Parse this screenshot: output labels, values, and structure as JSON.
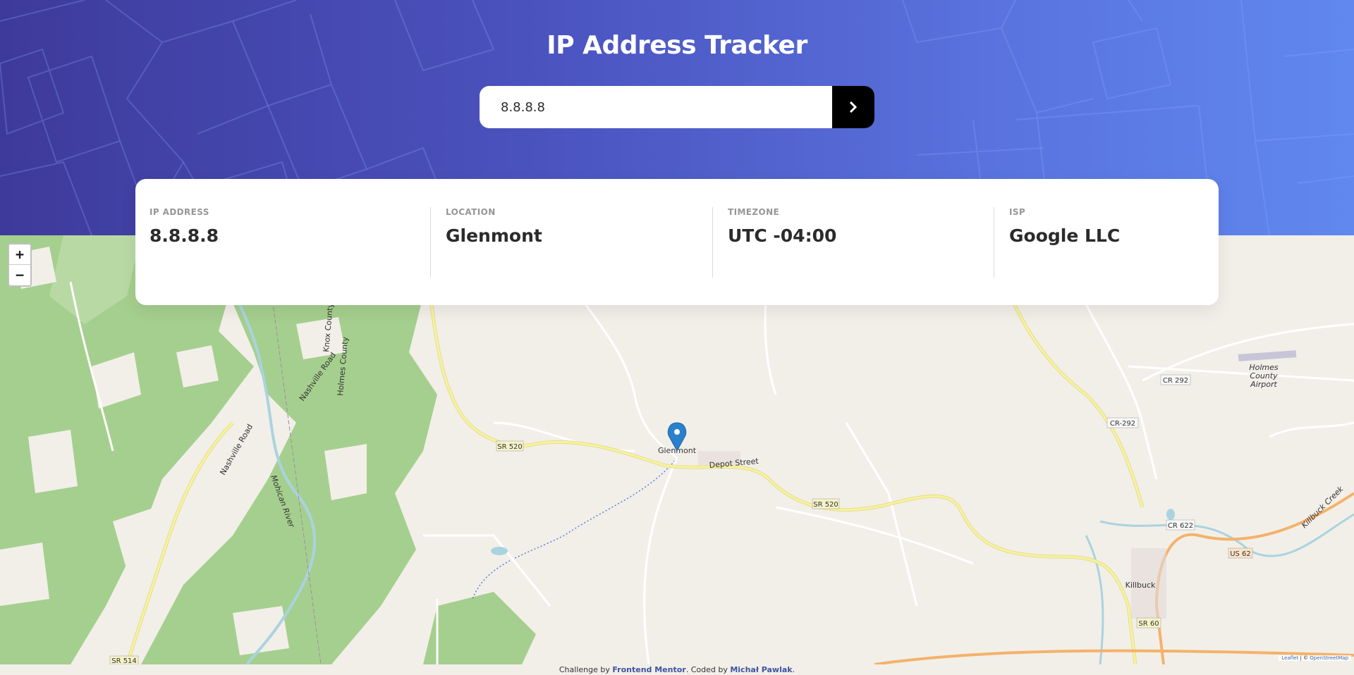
{
  "header": {
    "title": "IP Address Tracker",
    "search_value": "8.8.8.8",
    "submit_icon": "chevron-right-icon"
  },
  "info": {
    "ip": {
      "label": "IP ADDRESS",
      "value": "8.8.8.8"
    },
    "location": {
      "label": "LOCATION",
      "value": "Glenmont"
    },
    "timezone": {
      "label": "TIMEZONE",
      "value": "UTC -04:00"
    },
    "isp": {
      "label": "ISP",
      "value": "Google LLC"
    }
  },
  "map": {
    "zoom_in": "+",
    "zoom_out": "−",
    "marker_icon": "map-marker-icon",
    "places": {
      "glenmont": "Glenmont",
      "killbuck": "Killbuck",
      "airport_1": "Holmes",
      "airport_2": "County",
      "airport_3": "Airport"
    },
    "roads": {
      "sr520_a": "SR 520",
      "sr520_b": "SR 520",
      "cr292_a": "CR 292",
      "cr292_b": "CR-292",
      "cr622": "CR 622",
      "us62": "US 62",
      "sr60": "SR 60",
      "sr514": "SR 514",
      "depot": "Depot Street",
      "nashville_road_a": "Nashville Road",
      "nashville_road_b": "Nashville Road",
      "knox_county": "Knox County",
      "holmes_county": "Holmes County",
      "mohican_river": "Mohican River",
      "killbuck_creek": "Killbuck Creek"
    },
    "attribution": {
      "leaflet": "Leaflet",
      "sep": " | © ",
      "osm": "OpenStreetMap"
    }
  },
  "footer": {
    "prefix": "Challenge by ",
    "fm": "Frontend Mentor",
    "middle": ". Coded by ",
    "author": "Michał Pawlak",
    "suffix": "."
  },
  "colors": {
    "header_start": "#3e3a9b",
    "header_end": "#6088ef",
    "button": "#000000",
    "map_bg": "#f2efe9",
    "forest": "#a5cf8e",
    "road_yellow": "#f6f2a0",
    "marker": "#2a81cb"
  }
}
